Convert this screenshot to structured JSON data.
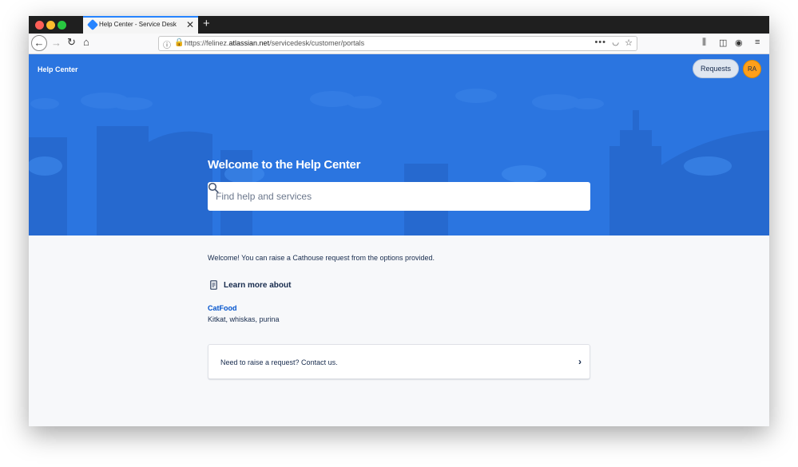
{
  "browser": {
    "tab_title": "Help Center - Service Desk",
    "tab_close": "✕",
    "new_tab": "+",
    "url_prefix": "https://felinez.",
    "url_host": "atlassian.net",
    "url_path": "/servicedesk/customer/portals",
    "page_actions": "•••"
  },
  "header": {
    "brand": "Help Center",
    "requests_label": "Requests",
    "avatar_initials": "RA"
  },
  "hero": {
    "title": "Welcome to the Help Center",
    "search_placeholder": "Find help and services"
  },
  "content": {
    "intro": "Welcome! You can raise a Cathouse request from the options provided.",
    "learn_title": "Learn more about",
    "kb_link": "CatFood",
    "kb_description": "Kitkat, whiskas, purina",
    "contact_text": "Need to raise a request? Contact us.",
    "contact_chevron": "›"
  },
  "colors": {
    "hero_blue": "#2b75e0",
    "link_blue": "#0052cc",
    "avatar_orange": "#ff9f1a"
  }
}
